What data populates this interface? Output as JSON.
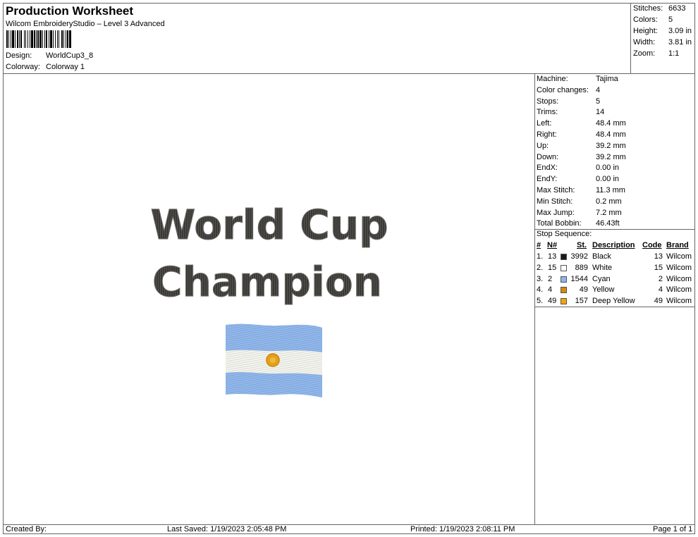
{
  "header": {
    "title": "Production Worksheet",
    "software": "Wilcom EmbroideryStudio – Level 3 Advanced",
    "design_label": "Design:",
    "design_value": "WorldCup3_8",
    "colorway_label": "Colorway:",
    "colorway_value": "Colorway 1"
  },
  "summary": [
    {
      "label": "Stitches:",
      "value": "6633"
    },
    {
      "label": "Colors:",
      "value": "5"
    },
    {
      "label": "Height:",
      "value": "3.09 in"
    },
    {
      "label": "Width:",
      "value": "3.81 in"
    },
    {
      "label": "Zoom:",
      "value": "1:1"
    }
  ],
  "machine_info": [
    {
      "label": "Machine:",
      "value": "Tajima"
    },
    {
      "label": "Color changes:",
      "value": "4"
    },
    {
      "label": "Stops:",
      "value": "5"
    },
    {
      "label": "Trims:",
      "value": "14"
    },
    {
      "label": "Left:",
      "value": "48.4 mm"
    },
    {
      "label": "Right:",
      "value": "48.4 mm"
    },
    {
      "label": "Up:",
      "value": "39.2 mm"
    },
    {
      "label": "Down:",
      "value": "39.2 mm"
    },
    {
      "label": "EndX:",
      "value": "0.00 in"
    },
    {
      "label": "EndY:",
      "value": "0.00 in"
    },
    {
      "label": "Max Stitch:",
      "value": "11.3 mm"
    },
    {
      "label": "Min Stitch:",
      "value": "0.2 mm"
    },
    {
      "label": "Max Jump:",
      "value": "7.2 mm"
    },
    {
      "label": "Total Bobbin:",
      "value": "46.43ft"
    }
  ],
  "stop_sequence": {
    "title": "Stop Sequence:",
    "headers": {
      "num": "#",
      "n": "N#",
      "st": "St.",
      "description": "Description",
      "code": "Code",
      "brand": "Brand"
    },
    "rows": [
      {
        "num": "1.",
        "n": "13",
        "color": "#1a1a1a",
        "st": "3992",
        "description": "Black",
        "code": "13",
        "brand": "Wilcom"
      },
      {
        "num": "2.",
        "n": "15",
        "color": "#ffffff",
        "st": "889",
        "description": "White",
        "code": "15",
        "brand": "Wilcom"
      },
      {
        "num": "3.",
        "n": "2",
        "color": "#8fb4f0",
        "st": "1544",
        "description": "Cyan",
        "code": "2",
        "brand": "Wilcom"
      },
      {
        "num": "4.",
        "n": "4",
        "color": "#d58a12",
        "st": "49",
        "description": "Yellow",
        "code": "4",
        "brand": "Wilcom"
      },
      {
        "num": "5.",
        "n": "49",
        "color": "#f5a30a",
        "st": "157",
        "description": "Deep Yellow",
        "code": "49",
        "brand": "Wilcom"
      }
    ]
  },
  "design": {
    "line1": "World Cup",
    "line2": "Champion"
  },
  "footer": {
    "created_by": "Created By:",
    "last_saved": "Last Saved: 1/19/2023 2:05:48 PM",
    "printed": "Printed: 1/19/2023 2:08:11 PM",
    "page": "Page 1 of 1"
  }
}
